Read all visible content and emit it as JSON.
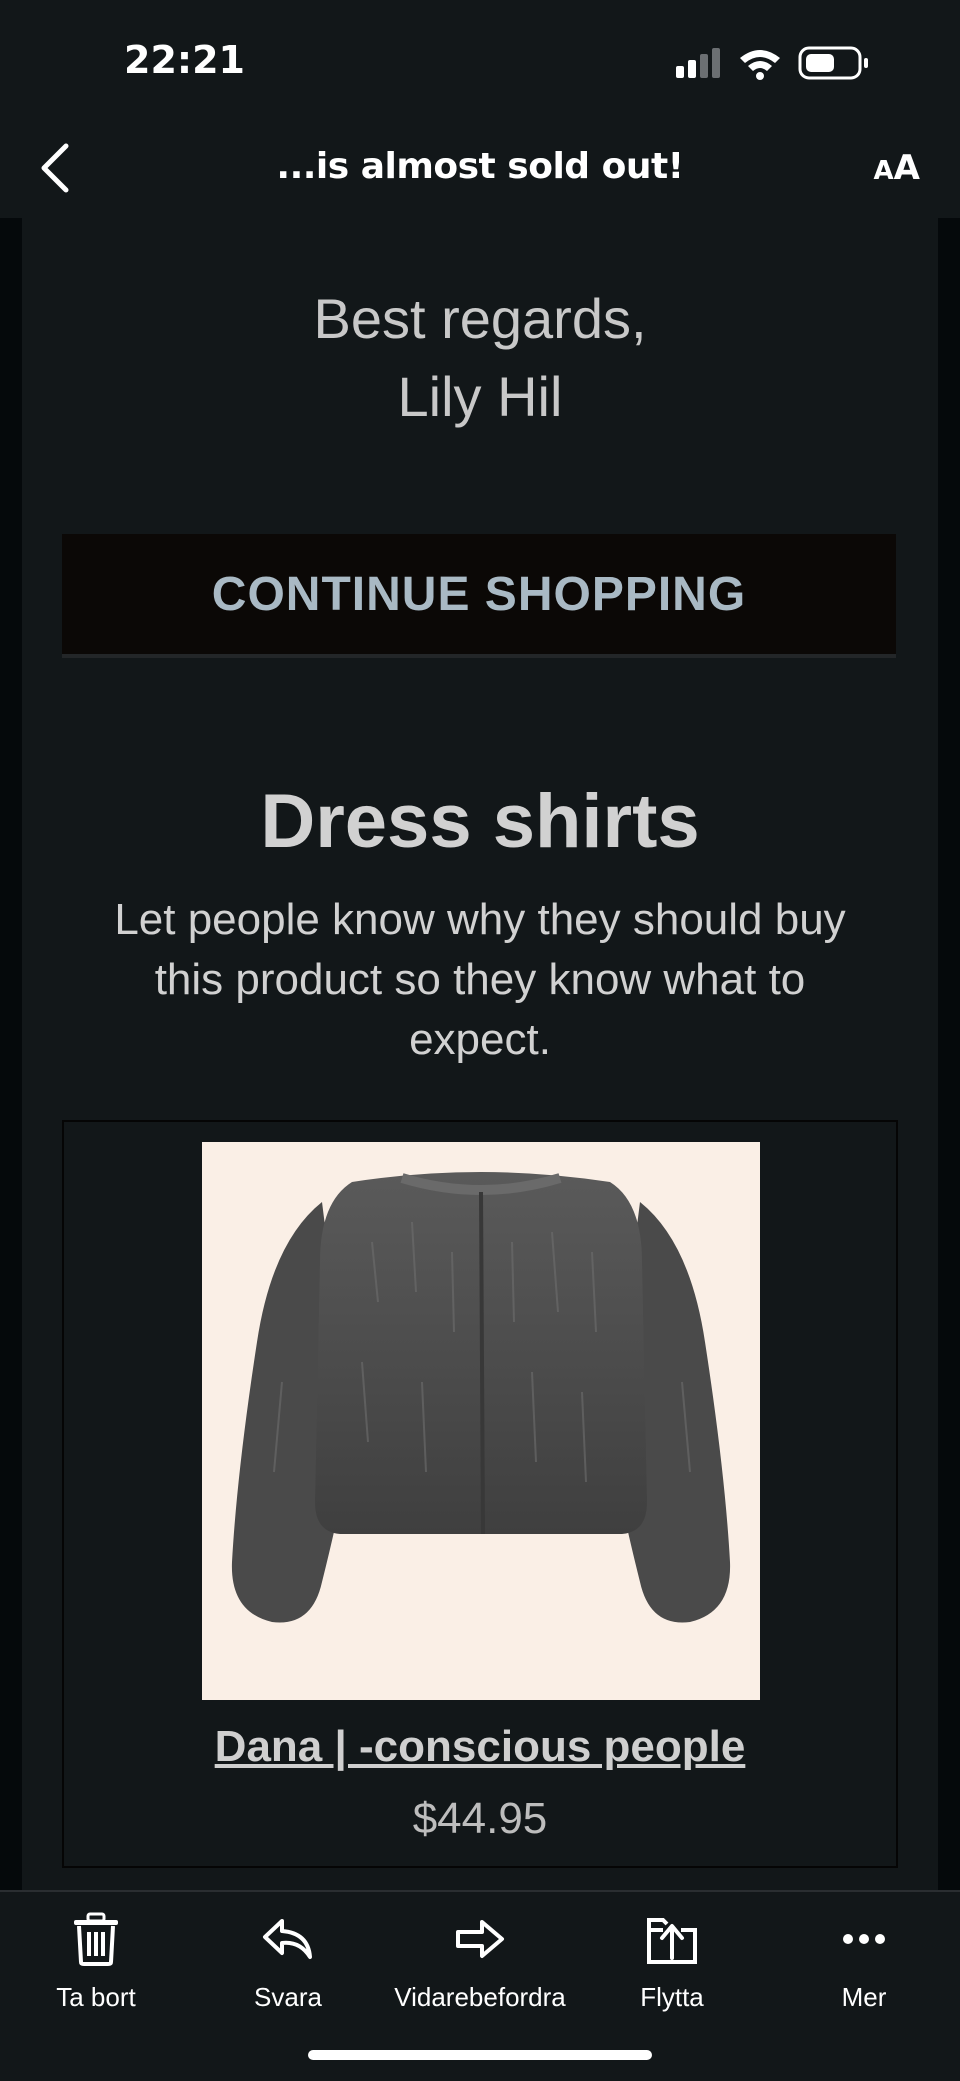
{
  "status_bar": {
    "time": "22:21"
  },
  "nav": {
    "title": "...is almost sold out!",
    "text_size_small": "A",
    "text_size_large": "A"
  },
  "email": {
    "regards_line1": "Best regards,",
    "regards_line2": "Lily Hil",
    "continue_button": "CONTINUE SHOPPING",
    "section_title": "Dress shirts",
    "section_desc_line1": "Let people know why they should buy",
    "section_desc_line2": "this product so they know what to",
    "section_desc_line3": "expect.",
    "product": {
      "name": "Dana | -conscious people",
      "price": "$44.95"
    }
  },
  "toolbar": {
    "delete_label": "Ta bort",
    "reply_label": "Svara",
    "forward_label": "Vidarebefordra",
    "move_label": "Flytta",
    "more_label": "Mer"
  },
  "colors": {
    "background": "#121719",
    "button_text": "#a9b9c4",
    "product_bg": "#faefe6"
  }
}
